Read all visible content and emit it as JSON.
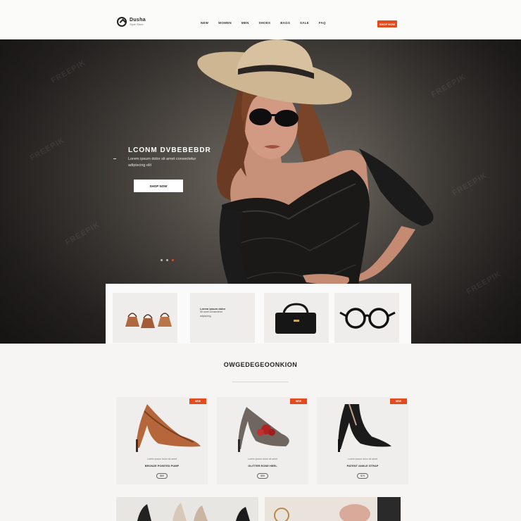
{
  "brand": {
    "name": "Dusha",
    "tagline": "Style Store"
  },
  "nav": {
    "items": [
      "NEW",
      "WOMEN",
      "MEN",
      "SHOES",
      "BAGS",
      "SALE",
      "FAQ"
    ],
    "cta": "SHOP NOW"
  },
  "hero": {
    "title": "LCONM DVBEBEBDR",
    "subtitle_line1": "Lorem ipsum dolor sit amet consectetur",
    "subtitle_line2": "adipiscing elit",
    "button": "SHOP NOW",
    "slides": 3,
    "active_slide": 2
  },
  "watermark": "FREEPIK",
  "categories": [
    {
      "name": "bags-category"
    },
    {
      "title": "Lorem ipsum dolor",
      "line1": "Sit amet consectetur",
      "line2": "adipiscing"
    },
    {
      "name": "handbag-category"
    },
    {
      "name": "sunglasses-category"
    }
  ],
  "section": {
    "title": "OWGEDEGEOONKION"
  },
  "products": [
    {
      "badge": "NEW",
      "desc": "Lorem ipsum dolor sit amet",
      "name": "BRONZE POINTED PUMP",
      "price": "$89"
    },
    {
      "badge": "NEW",
      "desc": "Lorem ipsum dolor sit amet",
      "name": "GLITTER ROSE HEEL",
      "price": "$95"
    },
    {
      "badge": "NEW",
      "desc": "Lorem ipsum dolor sit amet",
      "name": "PATENT ANKLE STRAP",
      "price": "$79"
    }
  ],
  "colors": {
    "accent": "#e34b1f",
    "dark": "#222222",
    "background": "#f6f5f3"
  }
}
